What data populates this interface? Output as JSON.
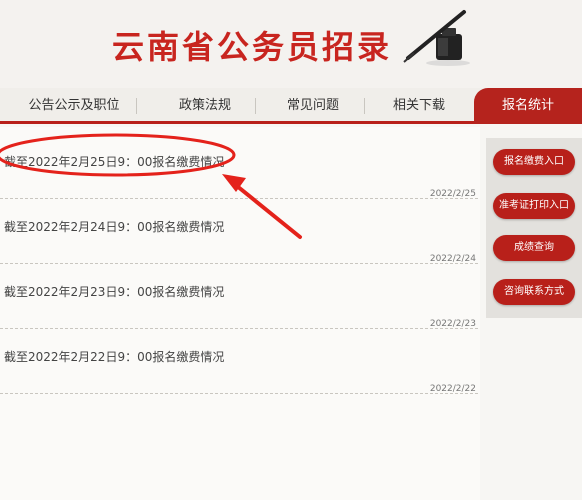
{
  "header": {
    "title": "云南省公务员招录",
    "icon": "ink-pen-icon"
  },
  "nav": {
    "items": [
      {
        "label": "公告公示及职位",
        "active": false
      },
      {
        "label": "政策法规",
        "active": false
      },
      {
        "label": "常见问题",
        "active": false
      },
      {
        "label": "相关下载",
        "active": false
      },
      {
        "label": "报名统计",
        "active": true
      }
    ],
    "accent_color": "#b5231d"
  },
  "news": [
    {
      "title": "截至2022年2月25日9：00报名缴费情况",
      "date": "2022/2/25"
    },
    {
      "title": "截至2022年2月24日9：00报名缴费情况",
      "date": "2022/2/24"
    },
    {
      "title": "截至2022年2月23日9：00报名缴费情况",
      "date": "2022/2/23"
    },
    {
      "title": "截至2022年2月22日9：00报名缴费情况",
      "date": "2022/2/22"
    }
  ],
  "sidebar": {
    "buttons": [
      {
        "label": "报名缴费入口"
      },
      {
        "label": "准考证打印入口"
      },
      {
        "label": "成绩查询"
      },
      {
        "label": "咨询联系方式"
      }
    ]
  },
  "annotation": {
    "color": "#e4221b",
    "shapes": [
      "ellipse-highlight",
      "arrow"
    ]
  }
}
